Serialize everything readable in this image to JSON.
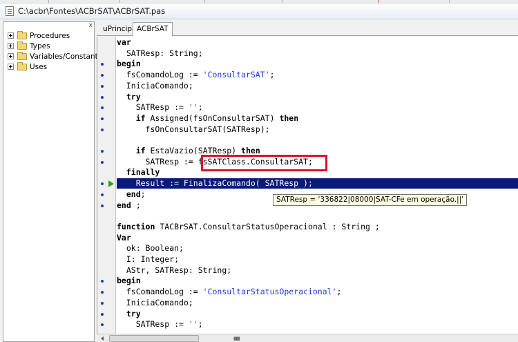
{
  "window": {
    "title": "C:\\acbr\\Fontes\\ACBrSAT\\ACBrSAT.pas"
  },
  "tree": {
    "close_label": "x",
    "items": [
      {
        "label": "Procedures"
      },
      {
        "label": "Types"
      },
      {
        "label": "Variables/Constants"
      },
      {
        "label": "Uses"
      }
    ]
  },
  "tabs": [
    {
      "label": "uPrincipal",
      "active": false
    },
    {
      "label": "ACBrSAT",
      "active": true
    }
  ],
  "code_lines": [
    {
      "text": "var",
      "kw": true,
      "dot": false
    },
    {
      "text": "  SATResp: String;",
      "dot": false
    },
    {
      "text": "begin",
      "kw": true,
      "dot": true
    },
    {
      "text": "  fsComandoLog := 'ConsultarSAT';",
      "dot": true
    },
    {
      "text": "  IniciaComando;",
      "dot": true
    },
    {
      "text": "  try",
      "kw": true,
      "dot": true
    },
    {
      "text": "    SATResp := '';",
      "dot": true
    },
    {
      "text": "    if Assigned(fsOnConsultarSAT) then",
      "dot": true
    },
    {
      "text": "      fsOnConsultarSAT(SATResp);",
      "dot": true
    },
    {
      "text": "",
      "dot": false
    },
    {
      "text": "    if EstaVazio(SATResp) then",
      "dot": true
    },
    {
      "text": "      SATResp := fsSATClass.ConsultarSAT;",
      "dot": true
    },
    {
      "text": "  finally",
      "kw": true,
      "dot": false
    },
    {
      "text": "    Result := FinalizaComando( SATResp );",
      "dot": true,
      "exec": true
    },
    {
      "text": "  end;",
      "dot": true
    },
    {
      "text": "end ;",
      "dot": true
    },
    {
      "text": "",
      "dot": false
    },
    {
      "text": "function TACBrSAT.ConsultarStatusOperacional : String ;",
      "dot": false
    },
    {
      "text": "Var",
      "dot": false
    },
    {
      "text": "  ok: Boolean;",
      "dot": false
    },
    {
      "text": "  I: Integer;",
      "dot": false
    },
    {
      "text": "  AStr, SATResp: String;",
      "dot": false
    },
    {
      "text": "begin",
      "kw": true,
      "dot": true
    },
    {
      "text": "  fsComandoLog := 'ConsultarStatusOperacional';",
      "dot": true
    },
    {
      "text": "  IniciaComando;",
      "dot": true
    },
    {
      "text": "  try",
      "kw": true,
      "dot": true
    },
    {
      "text": "    SATResp := '';",
      "dot": true
    }
  ],
  "tooltip": {
    "text": "SATResp = '336822|08000|SAT-CFe em operação.||'"
  },
  "colors": {
    "exec_line": "#0a1a7a",
    "highlight_box": "#e0102a",
    "string_literal": "#1a3ad8",
    "breakpoint_dot": "#1b3fb0"
  }
}
